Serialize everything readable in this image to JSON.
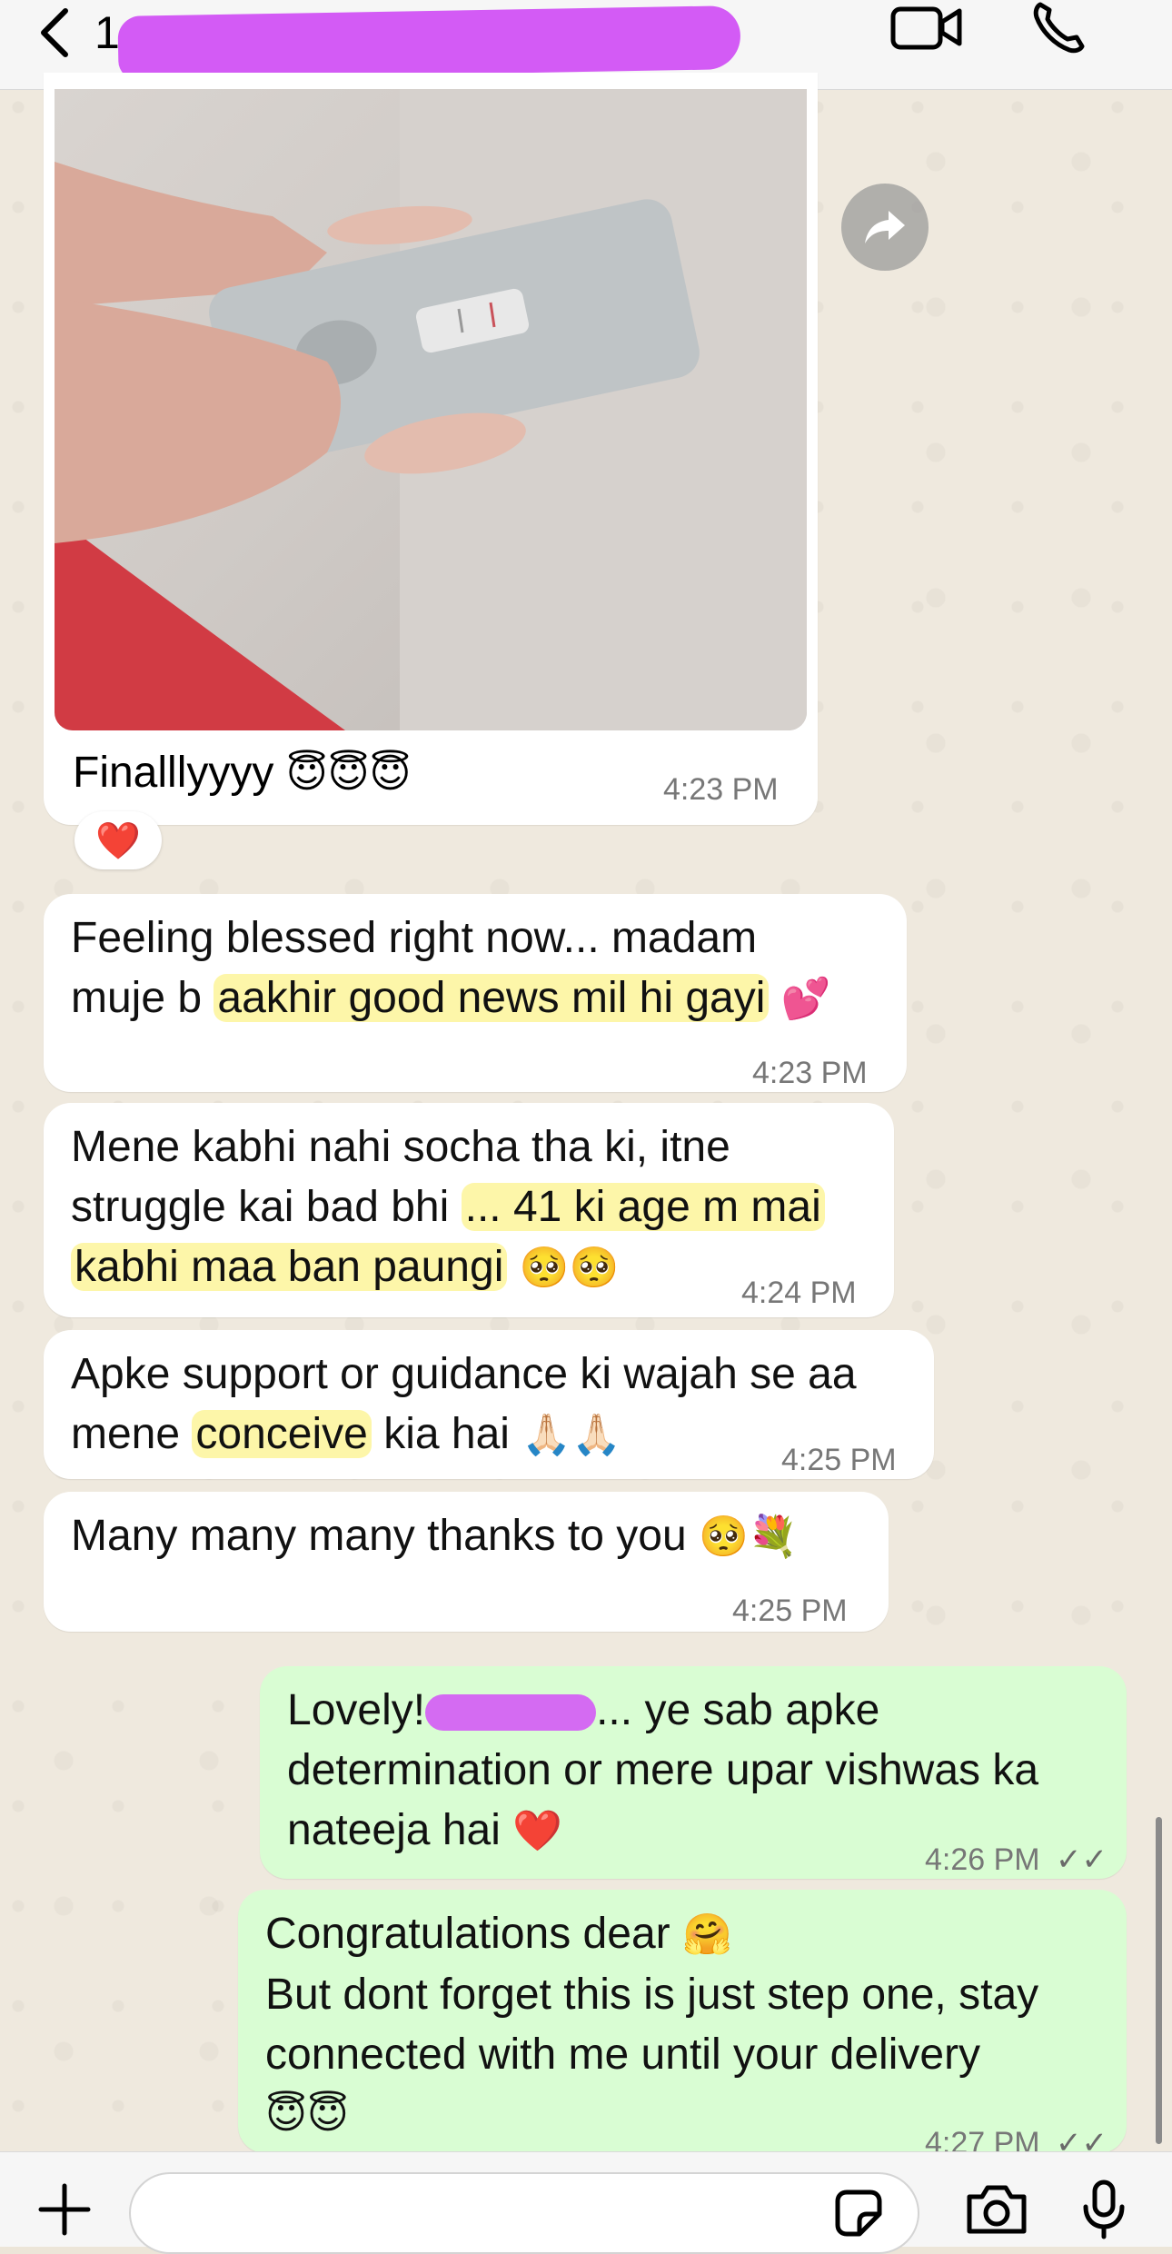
{
  "header": {
    "chat_name": "1",
    "back_icon": "chevron-left-icon",
    "video_icon": "video-call-icon",
    "phone_icon": "phone-icon"
  },
  "messages": [
    {
      "id": "m1",
      "text": "Finalllyyyy",
      "emoji": "😇😇😇",
      "time": "4:23 PM",
      "reaction": "❤️"
    },
    {
      "id": "m2",
      "line1": "Feeling blessed right now... madam",
      "line2_pre": "muje b ",
      "line2_hl": "aakhir good news mil hi gayi",
      "emoji": "💕",
      "time": "4:23 PM"
    },
    {
      "id": "m3",
      "line1": "Mene kabhi nahi socha tha ki, itne",
      "line2_pre": "struggle kai bad bhi ",
      "line2_hl": "... 41 ki age m mai",
      "line3_hl": "kabhi maa ban paungi",
      "emoji": "🥺🥺",
      "time": "4:24 PM"
    },
    {
      "id": "m4",
      "line1": "Apke support or guidance ki wajah se aa",
      "line2_pre": "mene ",
      "line2_hl": "conceive",
      "line2_post": " kia hai",
      "emoji": "🙏🏻🙏🏻",
      "time": "4:25 PM"
    },
    {
      "id": "m5",
      "text": "Many many many thanks to you",
      "emoji": "🥺💐",
      "time": "4:25 PM"
    },
    {
      "id": "m6",
      "line1_pre": "Lovely!",
      "line1_post": "... ye sab apke",
      "line2": "determination or mere upar vishwas ka",
      "line3": "nateeja hai",
      "emoji": "❤️",
      "time": "4:26 PM",
      "status": "✓✓"
    },
    {
      "id": "m7",
      "line1": "Congratulations dear",
      "line1_emoji": "🤗",
      "line2": "But dont forget this is just step one, stay",
      "line3": "connected with me until your delivery",
      "line4_emoji": "😇😇",
      "time": "4:27 PM",
      "status": "✓✓"
    }
  ],
  "colors": {
    "outgoing": "#d9fdd3",
    "incoming": "#ffffff",
    "highlight": "#fdf6a9",
    "redaction": "#d35bf5"
  }
}
